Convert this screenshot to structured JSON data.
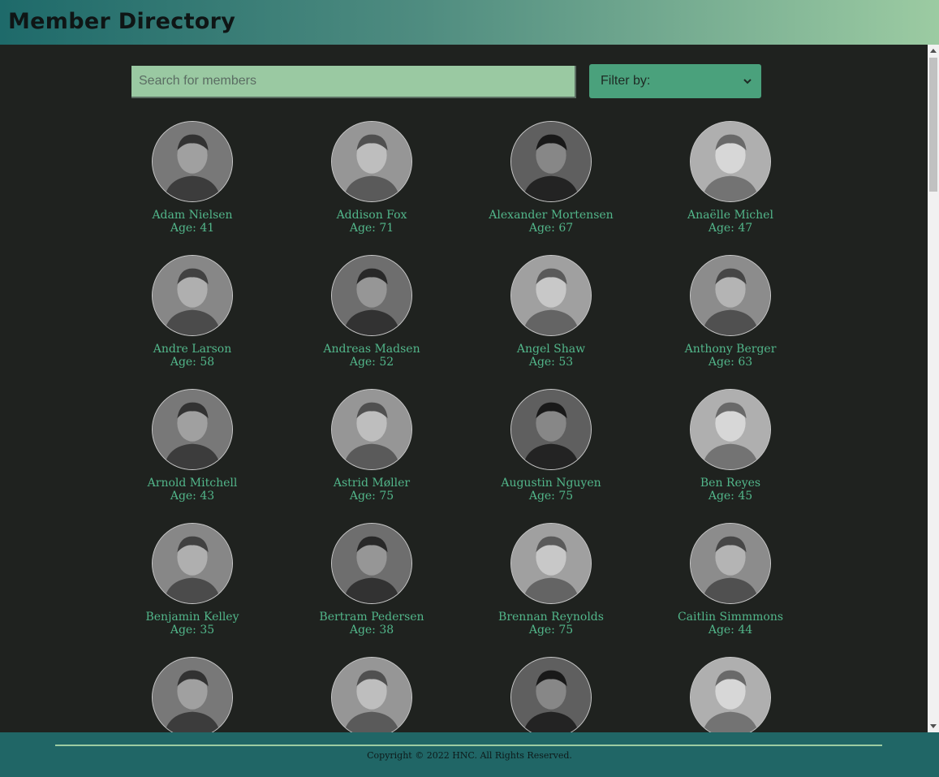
{
  "header": {
    "title": "Member Directory"
  },
  "search": {
    "placeholder": "Search for members",
    "value": ""
  },
  "filter": {
    "label": "Filter by:",
    "icon": "chevron-down-icon"
  },
  "members": [
    {
      "name": "Adam Nielsen",
      "age": "Age: 41"
    },
    {
      "name": "Addison Fox",
      "age": "Age: 71"
    },
    {
      "name": "Alexander Mortensen",
      "age": "Age: 67"
    },
    {
      "name": "Anaëlle Michel",
      "age": "Age: 47"
    },
    {
      "name": "Andre Larson",
      "age": "Age: 58"
    },
    {
      "name": "Andreas Madsen",
      "age": "Age: 52"
    },
    {
      "name": "Angel Shaw",
      "age": "Age: 53"
    },
    {
      "name": "Anthony Berger",
      "age": "Age: 63"
    },
    {
      "name": "Arnold Mitchell",
      "age": "Age: 43"
    },
    {
      "name": "Astrid Møller",
      "age": "Age: 75"
    },
    {
      "name": "Augustin Nguyen",
      "age": "Age: 75"
    },
    {
      "name": "Ben Reyes",
      "age": "Age: 45"
    },
    {
      "name": "Benjamin Kelley",
      "age": "Age: 35"
    },
    {
      "name": "Bertram Pedersen",
      "age": "Age: 38"
    },
    {
      "name": "Brennan Reynolds",
      "age": "Age: 75"
    },
    {
      "name": "Caitlin Simmmons",
      "age": "Age: 44"
    },
    {
      "name": "",
      "age": ""
    },
    {
      "name": "",
      "age": ""
    },
    {
      "name": "",
      "age": ""
    },
    {
      "name": "",
      "age": ""
    }
  ],
  "footer": {
    "copyright": "Copyright © 2022 HNC. All Rights Reserved."
  },
  "colors": {
    "background": "#1f221f",
    "accent_text": "#52b68a",
    "header_gradient_start": "#1e6a6a",
    "header_gradient_end": "#9ccba2",
    "footer": "#206666",
    "filter_button": "#4aa17c",
    "search_field": "#9ac9a2"
  }
}
